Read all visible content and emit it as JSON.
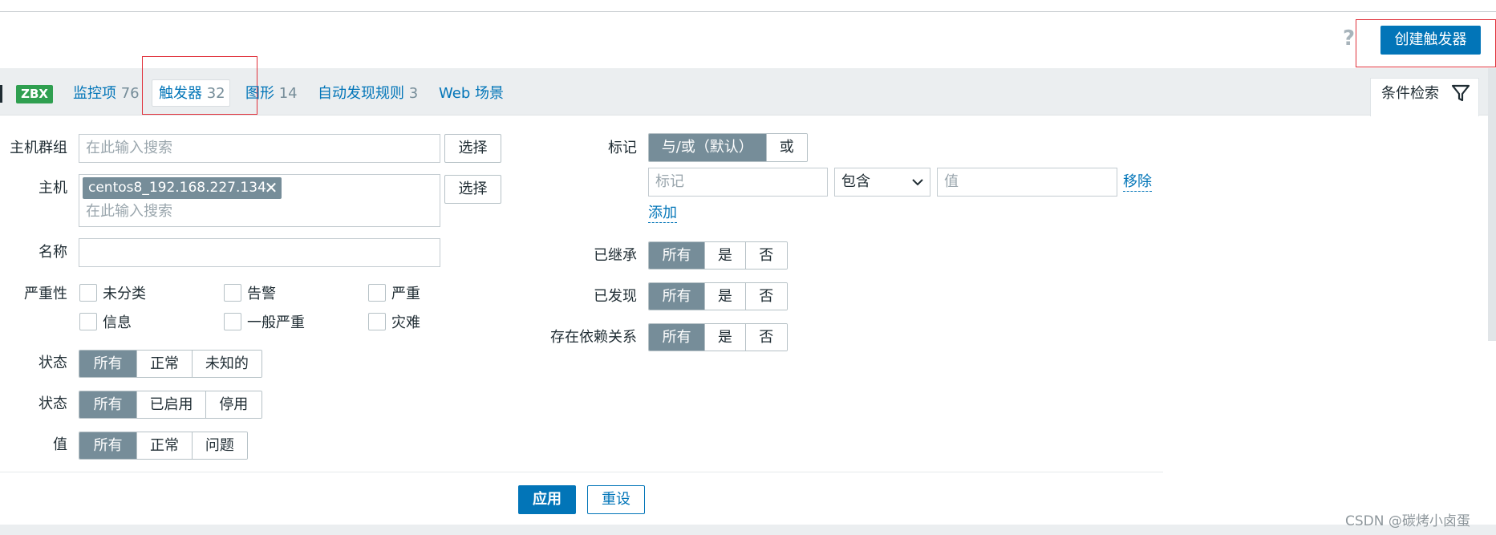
{
  "header": {
    "help": "?",
    "create_button": "创建触发器"
  },
  "host_tabs": {
    "badge": "ZBX",
    "items": [
      {
        "label": "监控项",
        "count": "76"
      },
      {
        "label": "触发器",
        "count": "32"
      },
      {
        "label": "图形",
        "count": "14"
      },
      {
        "label": "自动发现规则",
        "count": "3"
      },
      {
        "label": "Web 场景",
        "count": ""
      }
    ],
    "filter_tab": "条件检索"
  },
  "filter": {
    "host_group": {
      "label": "主机群组",
      "placeholder": "在此输入搜索",
      "select": "选择"
    },
    "host": {
      "label": "主机",
      "chip": "centos8_192.168.227.134",
      "chip_remove": "✕",
      "placeholder": "在此输入搜索",
      "select": "选择"
    },
    "name": {
      "label": "名称",
      "value": ""
    },
    "severity": {
      "label": "严重性",
      "options": [
        "未分类",
        "告警",
        "严重",
        "信息",
        "一般严重",
        "灾难"
      ]
    },
    "state": {
      "label": "状态",
      "options": [
        "所有",
        "正常",
        "未知的"
      ],
      "selected": "所有"
    },
    "status": {
      "label": "状态",
      "options": [
        "所有",
        "已启用",
        "停用"
      ],
      "selected": "所有"
    },
    "value": {
      "label": "值",
      "options": [
        "所有",
        "正常",
        "问题"
      ],
      "selected": "所有"
    },
    "tags": {
      "label": "标记",
      "operator_options": [
        "与/或（默认）",
        "或"
      ],
      "operator_selected": "与/或（默认）",
      "tag_placeholder": "标记",
      "condition": "包含",
      "value_placeholder": "值",
      "remove": "移除",
      "add": "添加"
    },
    "inherited": {
      "label": "已继承",
      "options": [
        "所有",
        "是",
        "否"
      ],
      "selected": "所有"
    },
    "discovered": {
      "label": "已发现",
      "options": [
        "所有",
        "是",
        "否"
      ],
      "selected": "所有"
    },
    "dependencies": {
      "label": "存在依赖关系",
      "options": [
        "所有",
        "是",
        "否"
      ],
      "selected": "所有"
    },
    "apply": "应用",
    "reset": "重设"
  },
  "watermark": "CSDN @碳烤小卤蛋",
  "colors": {
    "primary": "#0275b8",
    "segment_active": "#768d99",
    "badge_green": "#2f9f50",
    "annotation_red": "#e0303a"
  }
}
